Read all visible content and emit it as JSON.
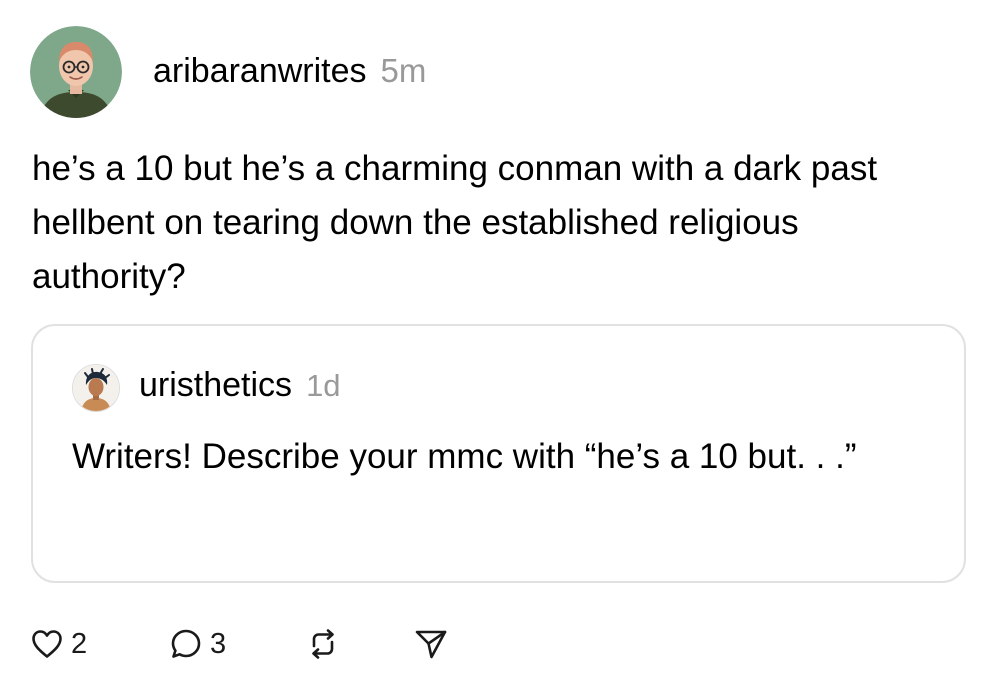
{
  "post": {
    "author": "aribaranwrites",
    "time": "5m",
    "text": "he’s a 10 but he’s a charming conman with a dark past hellbent on tearing down the established religious authority?",
    "quoted": {
      "author": "uristhetics",
      "time": "1d",
      "text": "Writers! Describe your mmc with “he’s a 10 but. . .”"
    },
    "actions": {
      "likes": "2",
      "replies": "3"
    }
  },
  "colors": {
    "text": "#000000",
    "muted": "#999999",
    "card_border": "#e1e1e1",
    "avatar_bg": "#7fa88a"
  },
  "icons": [
    "heart-icon",
    "comment-icon",
    "repost-icon",
    "share-icon"
  ]
}
